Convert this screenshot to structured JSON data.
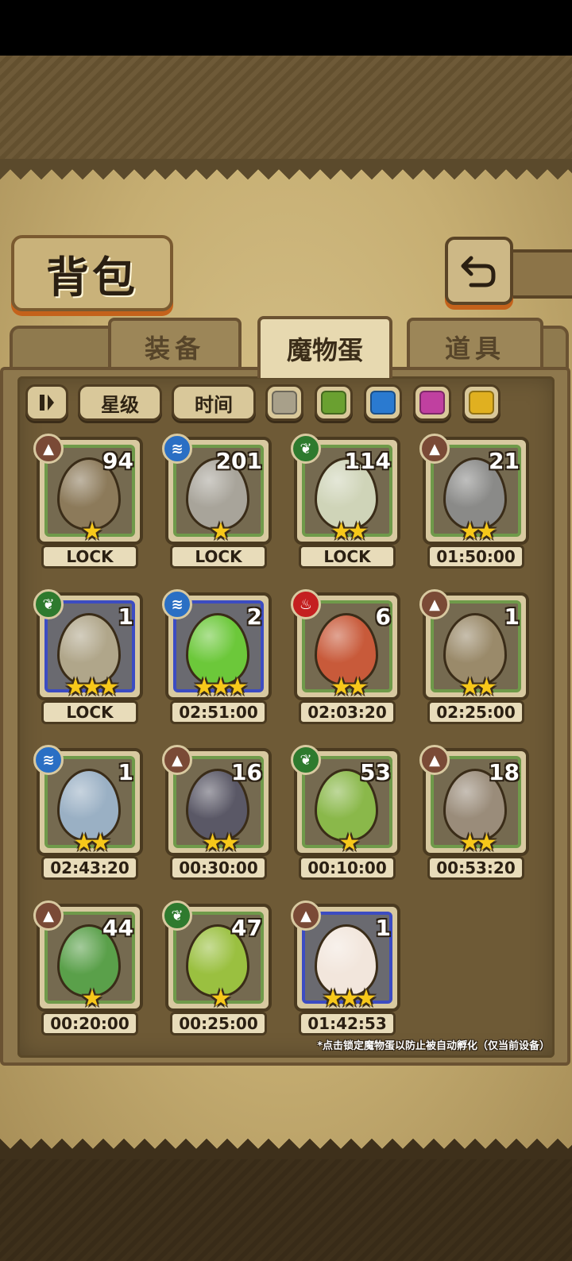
{
  "header": {
    "title": "背包",
    "back_icon": "back-arrow-icon"
  },
  "tabs": [
    {
      "label": "装备",
      "active": false
    },
    {
      "label": "魔物蛋",
      "active": true
    },
    {
      "label": "道具",
      "active": false
    }
  ],
  "filters": {
    "sort_icon": "pause-sort-icon",
    "star_label": "星级",
    "time_label": "时间",
    "colors": [
      "#a8a08a",
      "#6aa030",
      "#2a7ad0",
      "#c040a0",
      "#e0b020"
    ]
  },
  "eggs": [
    {
      "element": "earth",
      "element_icon": "mountain-icon",
      "count": "94",
      "stars": "★",
      "label": "LOCK",
      "rarity": "green",
      "color": "#8c7a5a"
    },
    {
      "element": "water",
      "element_icon": "wave-icon",
      "count": "201",
      "stars": "★",
      "label": "LOCK",
      "rarity": "green",
      "color": "#a8a49a"
    },
    {
      "element": "grass",
      "element_icon": "leaf-icon",
      "count": "114",
      "stars": "★★",
      "label": "LOCK",
      "rarity": "green",
      "color": "#cfd4b8"
    },
    {
      "element": "earth",
      "element_icon": "mountain-icon",
      "count": "21",
      "stars": "★★",
      "label": "01:50:00",
      "rarity": "green",
      "color": "#8a8a88"
    },
    {
      "element": "grass",
      "element_icon": "leaf-icon",
      "count": "1",
      "stars": "★★★",
      "label": "LOCK",
      "rarity": "blue",
      "color": "#b0a68a"
    },
    {
      "element": "water",
      "element_icon": "wave-icon",
      "count": "2",
      "stars": "★★★",
      "label": "02:51:00",
      "rarity": "blue",
      "color": "#6cc83a"
    },
    {
      "element": "fire",
      "element_icon": "flame-icon",
      "count": "6",
      "stars": "★★",
      "label": "02:03:20",
      "rarity": "green",
      "color": "#c85a3a"
    },
    {
      "element": "earth",
      "element_icon": "mountain-icon",
      "count": "1",
      "stars": "★★",
      "label": "02:25:00",
      "rarity": "green",
      "color": "#9a8a6a"
    },
    {
      "element": "water",
      "element_icon": "wave-icon",
      "count": "1",
      "stars": "★★",
      "label": "02:43:20",
      "rarity": "green",
      "color": "#9ab0c4"
    },
    {
      "element": "earth",
      "element_icon": "mountain-icon",
      "count": "16",
      "stars": "★★",
      "label": "00:30:00",
      "rarity": "green",
      "color": "#5a5866"
    },
    {
      "element": "grass",
      "element_icon": "leaf-icon",
      "count": "53",
      "stars": "★",
      "label": "00:10:00",
      "rarity": "green",
      "color": "#8ab84a"
    },
    {
      "element": "earth",
      "element_icon": "mountain-icon",
      "count": "18",
      "stars": "★★",
      "label": "00:53:20",
      "rarity": "green",
      "color": "#9a8c7a"
    },
    {
      "element": "earth",
      "element_icon": "mountain-icon",
      "count": "44",
      "stars": "★",
      "label": "00:20:00",
      "rarity": "green",
      "color": "#5aa04a"
    },
    {
      "element": "grass",
      "element_icon": "leaf-icon",
      "count": "47",
      "stars": "★",
      "label": "00:25:00",
      "rarity": "green",
      "color": "#9ac040"
    },
    {
      "element": "earth",
      "element_icon": "mountain-icon",
      "count": "1",
      "stars": "★★★",
      "label": "01:42:53",
      "rarity": "blue",
      "color": "#f2e6dc"
    }
  ],
  "footnote": "*点击锁定魔物蛋以防止被自动孵化（仅当前设备）"
}
